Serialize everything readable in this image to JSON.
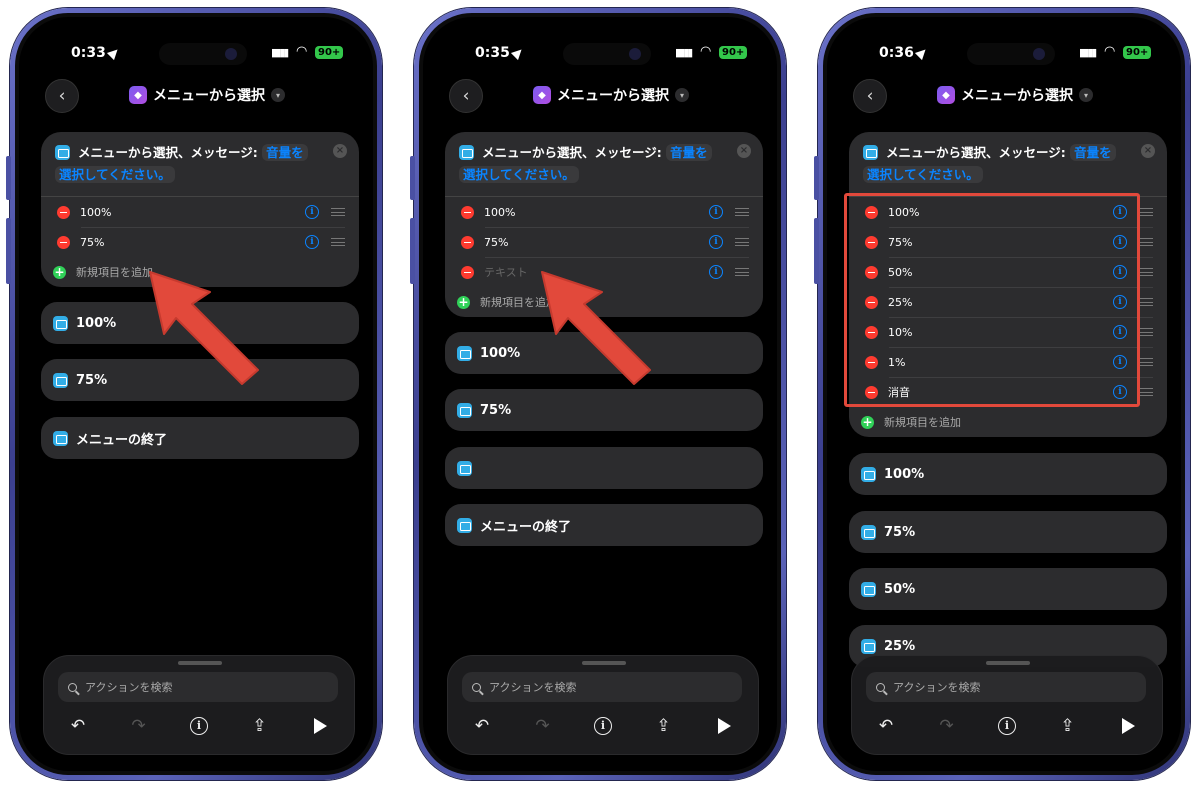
{
  "common": {
    "title": "メニューから選択",
    "header_prefix": "メニューから選択、メッセージ:",
    "prompt_part1": "音量を",
    "prompt_part2": "選択してください。",
    "add_item": "新規項目を追加",
    "end_menu": "メニューの終了",
    "search_placeholder": "アクションを検索",
    "battery": "90+"
  },
  "phones": [
    {
      "time": "0:33",
      "items": [
        "100%",
        "75%"
      ],
      "blocks": [
        "100%",
        "75%",
        "メニューの終了"
      ]
    },
    {
      "time": "0:35",
      "items": [
        "100%",
        "75%"
      ],
      "placeholder_item": "テキスト",
      "blocks": [
        "100%",
        "75%",
        "",
        "メニューの終了"
      ]
    },
    {
      "time": "0:36",
      "items": [
        "100%",
        "75%",
        "50%",
        "25%",
        "10%",
        "1%",
        "消音"
      ],
      "blocks": [
        "100%",
        "75%",
        "50%",
        "25%"
      ]
    }
  ],
  "colors": {
    "accent": "#0a84ff",
    "annotation": "#e2493b",
    "remove": "#ff3b30",
    "add": "#30d158",
    "block_icon": "#32ade6"
  }
}
